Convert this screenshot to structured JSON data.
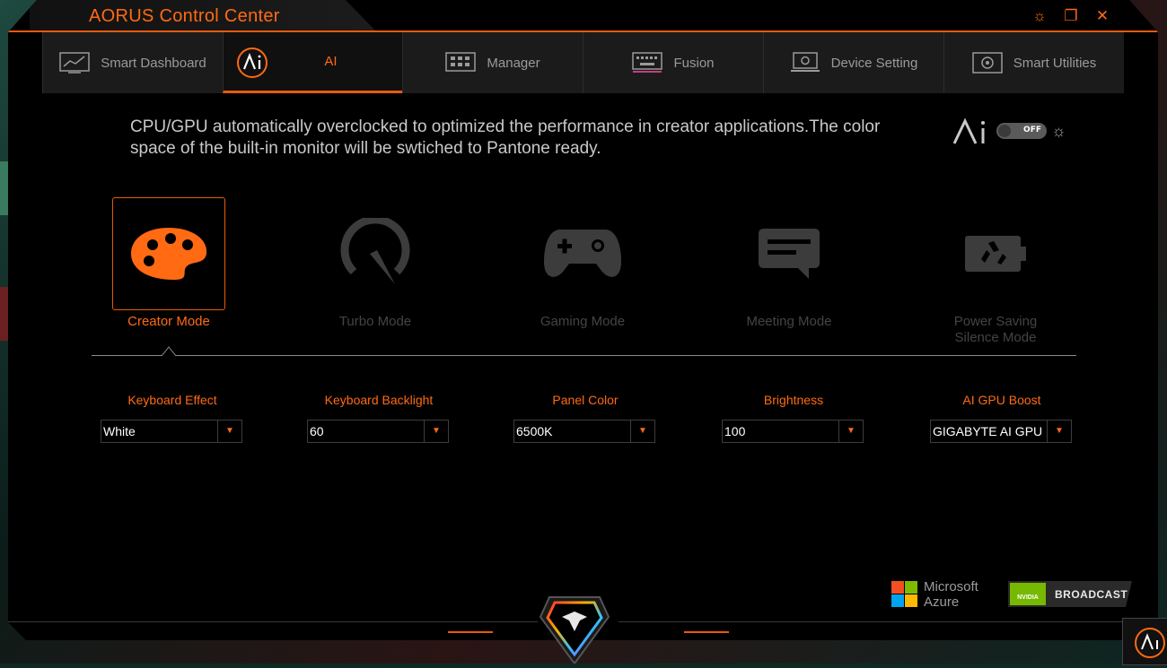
{
  "app": {
    "title": "AORUS Control Center"
  },
  "window_controls": {
    "settings": "☼",
    "restore": "❐",
    "close": "✕"
  },
  "tabs": [
    {
      "label": "Smart Dashboard",
      "icon": "dashboard-icon",
      "active": false
    },
    {
      "label": "AI",
      "icon": "ai-icon",
      "active": true
    },
    {
      "label": "Manager",
      "icon": "manager-icon",
      "active": false
    },
    {
      "label": "Fusion",
      "icon": "keyboard-icon",
      "active": false
    },
    {
      "label": "Device Setting",
      "icon": "device-setting-icon",
      "active": false
    },
    {
      "label": "Smart Utilities",
      "icon": "smart-utilities-icon",
      "active": false
    }
  ],
  "description": "CPU/GPU automatically overclocked to optimized the performance in creator applications.The color space of the built-in monitor will be swtiched to Pantone ready.",
  "ai_toggle": {
    "state": "OFF"
  },
  "modes": [
    {
      "label": "Creator Mode",
      "icon": "palette-icon",
      "selected": true
    },
    {
      "label": "Turbo Mode",
      "icon": "speedometer-icon",
      "selected": false
    },
    {
      "label": "Gaming Mode",
      "icon": "gamepad-icon",
      "selected": false
    },
    {
      "label": "Meeting Mode",
      "icon": "chat-icon",
      "selected": false
    },
    {
      "label": "Power Saving\nSilence Mode",
      "label_line1": "Power Saving",
      "label_line2": "Silence Mode",
      "icon": "recycle-battery-icon",
      "selected": false
    }
  ],
  "settings": [
    {
      "label": "Keyboard Effect",
      "value": "White"
    },
    {
      "label": "Keyboard Backlight",
      "value": "60"
    },
    {
      "label": "Panel Color",
      "value": "6500K"
    },
    {
      "label": "Brightness",
      "value": "100"
    },
    {
      "label": "AI GPU Boost",
      "value": "GIGABYTE AI GPU"
    }
  ],
  "partners": {
    "microsoft_line1": "Microsoft",
    "microsoft_line2": "Azure",
    "nvidia_badge": "NVIDIA",
    "nvidia_text": "BROADCAST"
  },
  "colors": {
    "accent": "#e85a0c",
    "accent_text": "#ff6a13",
    "inactive": "#444444"
  }
}
